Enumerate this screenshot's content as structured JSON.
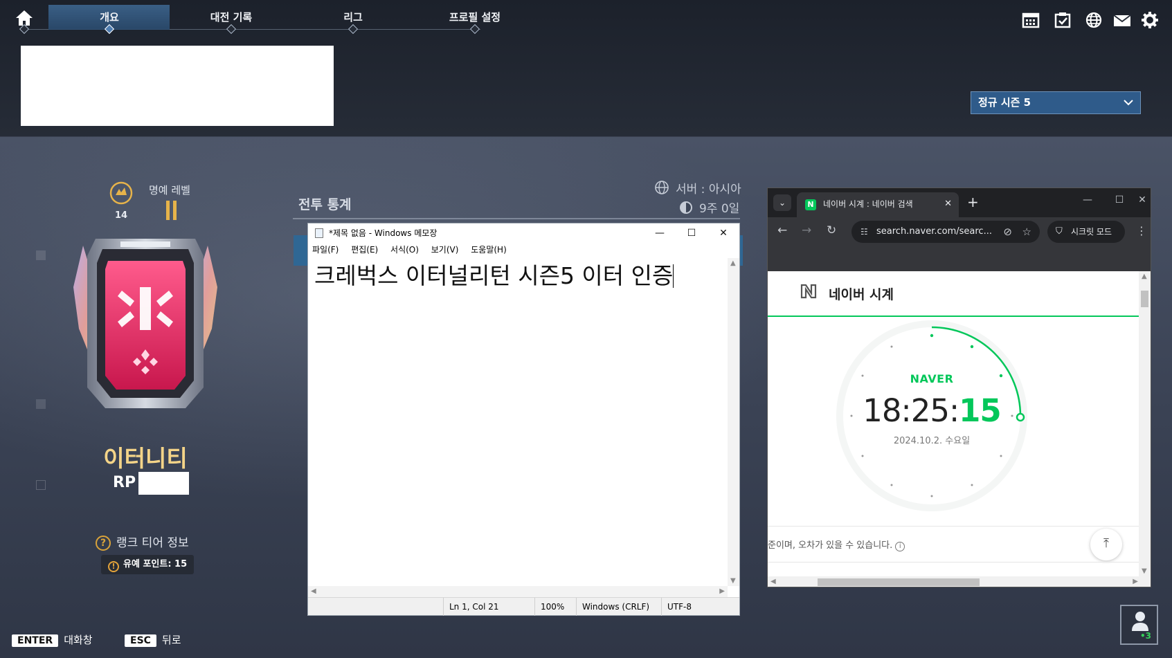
{
  "nav": {
    "tabs": [
      "개요",
      "대전 기록",
      "리그",
      "프로필 설정"
    ],
    "active_index": 0,
    "season_select": "정규 시즌 5"
  },
  "profile": {
    "honor_label": "명예 레벨",
    "honor_level": "14",
    "tier_name": "이터니티",
    "rp_label": "RP",
    "rank_info": "랭크 티어 정보",
    "points_badge": "유예 포인트: 15"
  },
  "stats": {
    "title": "전투 통계",
    "server": "서버 : 아시아",
    "period": "9주 0일"
  },
  "notepad": {
    "title": "*제목 없음 - Windows 메모장",
    "menu": [
      "파일(F)",
      "편집(E)",
      "서식(O)",
      "보기(V)",
      "도움말(H)"
    ],
    "content": "크레벅스 이터널리턴 시즌5 이터 인증",
    "status": {
      "position": "Ln 1, Col 21",
      "zoom": "100%",
      "line_ending": "Windows (CRLF)",
      "encoding": "UTF-8"
    }
  },
  "browser": {
    "tab_title": "네이버 시계 : 네이버 검색",
    "favicon": "N",
    "url": "search.naver.com/searc...",
    "incognito": "시크릿 모드",
    "page_title": "네이버 시계",
    "brand": "NAVER",
    "time_hm": "18:25:",
    "time_s": "15",
    "date": "2024.10.2. 수요일",
    "note": "준이며, 오차가 있을 수 있습니다."
  },
  "hints": {
    "enter_key": "ENTER",
    "enter_label": "대화창",
    "esc_key": "ESC",
    "esc_label": "뒤로",
    "friends_count": "3"
  },
  "icons": [
    "home-icon",
    "calendar-icon",
    "mission-icon",
    "globe-icon",
    "mail-icon",
    "gear-icon",
    "friends-icon"
  ],
  "colors": {
    "accent_blue": "#2f5b8a",
    "tier_gold": "#f4d488",
    "naver_green": "#03c75a"
  }
}
